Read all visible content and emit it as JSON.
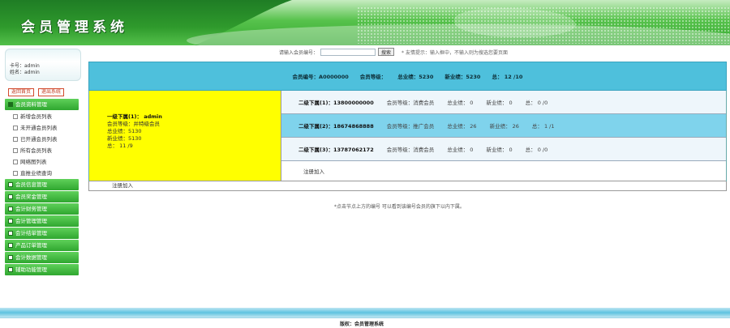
{
  "header": {
    "title": "会员管理系统"
  },
  "sidebar": {
    "card_no": "卡号：admin",
    "name": "姓名：admin",
    "buttons": {
      "home": "返回首页",
      "logout": "退出系统"
    },
    "menu": [
      {
        "label": "会员资料管理",
        "open": true,
        "children": [
          "新增会员列表",
          "未开通会员列表",
          "已开通会员列表",
          "所有会员列表",
          "网络图列表",
          "直推业绩查询"
        ]
      },
      {
        "label": "会员信息管理"
      },
      {
        "label": "会员奖金管理"
      },
      {
        "label": "会计财务管理"
      },
      {
        "label": "会计管理管理"
      },
      {
        "label": "会计结单管理"
      },
      {
        "label": "产品订单管理"
      },
      {
        "label": "会计数据管理"
      },
      {
        "label": "辅助功能管理"
      }
    ]
  },
  "search": {
    "label": "请输入会员编号：",
    "input_value": "",
    "button": "搜索",
    "tip": "* 友情提示：输入框中，不输入则为搜选您要页面"
  },
  "tree": {
    "top": {
      "member_no": "会员编号：A0000000",
      "level": "会员等级：",
      "total": "总业绩：5230",
      "new": "新业绩：5230",
      "sum": "总：  12 /10"
    },
    "left": {
      "title": "一级下属(1)：   admin",
      "level": "会员等级：并特级会员",
      "total": "总业绩：5130",
      "new": "新业绩：5130",
      "sum": "总：  11 /9"
    },
    "children": [
      {
        "id": "二级下属(1)：13800000000",
        "level": "会员等级：消费会员",
        "total": "总业绩：  0",
        "new": "新业绩：  0",
        "sum": "总：  0 /0"
      },
      {
        "id": "二级下属(2)：18674868888",
        "level": "会员等级：推广会员",
        "total": "总业绩：  26",
        "new": "新业绩：  26",
        "sum": "总：  1 /1"
      },
      {
        "id": "二级下属(3)：13787062172",
        "level": "会员等级：消费会员",
        "total": "总业绩：  0",
        "new": "新业绩：  0",
        "sum": "总：  0 /0"
      }
    ],
    "register_right": "注册加入",
    "register_left": "注册加入"
  },
  "note": "*点击节点上方的编号 可以看到该编号会员的旗下以内下属。",
  "footer": "版权：会员管理系统"
}
